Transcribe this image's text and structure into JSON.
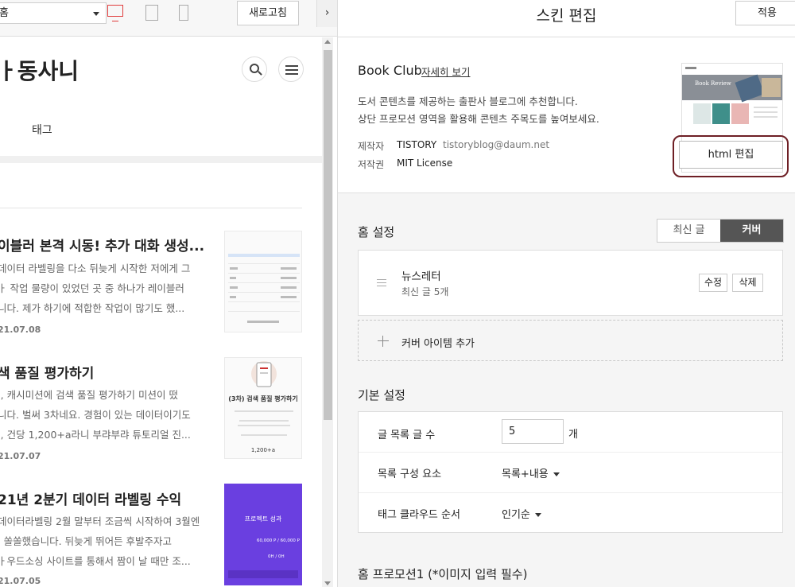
{
  "preview": {
    "category_select": "홈",
    "refresh_label": "새로고침",
    "collapse_glyph": "›",
    "blog_title": "ㅏ동사니",
    "nav_tag": "태그",
    "posts": [
      {
        "title": "이블러 본격 시동! 추가 대화 생성...",
        "excerpt": [
          "데이터 라벨링을 다소 뒤늦게 시작한 저에게 그",
          "ㅏ 작업 물량이 있었던 곳 중 하나가 레이블러",
          "니다. 제가 하기에 적합한 작업이 많기도 했..."
        ],
        "date": "21.07.08"
      },
      {
        "title": "색 품질 평가하기",
        "excerpt": [
          "I, 캐시미션에 검색 품질 평가하기 미션이 떴",
          "니다. 벌써 3차네요. 경험이 있는 데이터이기도",
          "I, 건당 1,200+a라니 부랴부랴 튜토리얼 진..."
        ],
        "date": "21.07.07",
        "thumb_title": "(3차) 검색 품질 평가하기",
        "thumb_reward": "1,200+a"
      },
      {
        "title": "21년 2분기 데이터 라벨링 수익",
        "excerpt": [
          "데이터라벨링 2월 말부터 조금씩 시작하여 3월엔",
          "I 쏠쏠했습니다. 뒤늦게 뛰어든 후발주자고",
          "ㅏ우드소싱 사이트를 통해서 짬이 날 때만 조..."
        ],
        "date": "21.07.05",
        "thumb_title": "프로젝트 성과",
        "thumb_amount": "60,000 P / 60,000 P",
        "thumb_hours": "0H / 0H"
      }
    ]
  },
  "editor": {
    "title": "스킨 편집",
    "apply_label": "적용",
    "skin": {
      "name": "Book Club",
      "more_link": "자세히 보기",
      "desc": [
        "도서 콘텐츠를 제공하는 출판사 블로그에 추천합니다.",
        "상단 프로모션 영역을 활용해 콘텐츠 주목도를 높여보세요."
      ],
      "maker_label": "제작자",
      "maker": "TISTORY",
      "maker_email": "tistoryblog@daum.net",
      "license_label": "저작권",
      "license": "MIT License",
      "thumb_caption": "Book Review",
      "html_edit_label": "html 편집"
    },
    "home": {
      "title": "홈 설정",
      "tab_latest": "최신 글",
      "tab_cover": "커버",
      "cover_item": {
        "title": "뉴스레터",
        "sub": "최신 글 5개",
        "edit_label": "수정",
        "delete_label": "삭제"
      },
      "add_cover_label": "커버 아이템 추가"
    },
    "basic": {
      "title": "기본 설정",
      "post_count_label": "글 목록 글 수",
      "post_count_value": "5",
      "post_count_unit": "개",
      "list_compose_label": "목록 구성 요소",
      "list_compose_value": "목록+내용",
      "tag_order_label": "태그 클라우드 순서",
      "tag_order_value": "인기순"
    },
    "promo_title": "홈 프로모션1 (*이미지 입력 필수)"
  },
  "colors": {
    "active_device": "#e03c3c",
    "highlight_outline": "#6e1f25",
    "cover_tab_bg": "#555555",
    "promo_purple": "#6a3fe0"
  }
}
